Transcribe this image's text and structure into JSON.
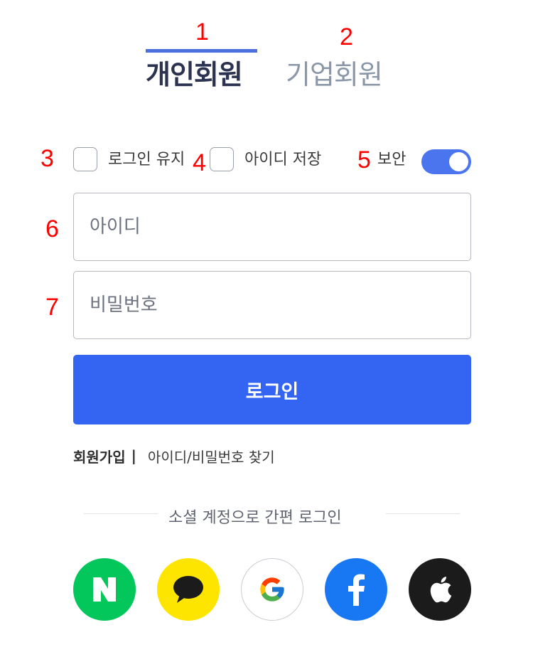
{
  "annotations": [
    "1",
    "2",
    "3",
    "4",
    "5",
    "6",
    "7"
  ],
  "tabs": {
    "personal": "개인회원",
    "business": "기업회원"
  },
  "options": {
    "keep_login": "로그인 유지",
    "save_id": "아이디 저장",
    "security": "보안",
    "security_on": true
  },
  "form": {
    "id_placeholder": "아이디",
    "password_placeholder": "비밀번호",
    "login_button": "로그인"
  },
  "links": {
    "signup": "회원가입",
    "separator": "|",
    "find": "아이디/비밀번호 찾기"
  },
  "social": {
    "divider_text": "소셜 계정으로 간편 로그인",
    "providers": [
      {
        "name": "naver",
        "icon": "naver-icon",
        "color": "#03c75a"
      },
      {
        "name": "kakao",
        "icon": "kakao-icon",
        "color": "#fee500"
      },
      {
        "name": "google",
        "icon": "google-icon",
        "color": "#ffffff"
      },
      {
        "name": "facebook",
        "icon": "facebook-icon",
        "color": "#1877f2"
      },
      {
        "name": "apple",
        "icon": "apple-icon",
        "color": "#1b1b1b"
      }
    ]
  },
  "colors": {
    "accent": "#3464f2",
    "tab_underline": "#4c6fe0",
    "annotation": "#ff0000"
  }
}
